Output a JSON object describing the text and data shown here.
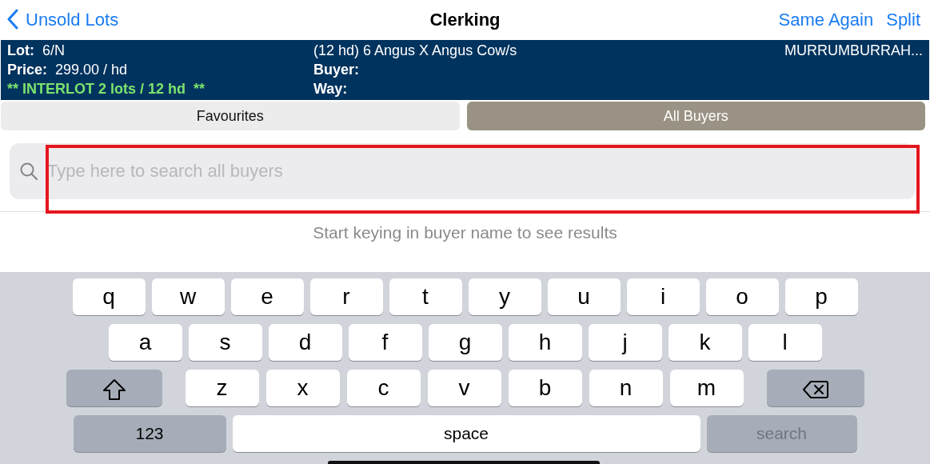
{
  "nav": {
    "back_label": "Unsold Lots",
    "title": "Clerking",
    "actions": [
      "Same Again",
      "Split"
    ]
  },
  "lot_info": {
    "lot_label": "Lot:",
    "lot_value": "6/N",
    "price_label": "Price:",
    "price_value": "299.00 / hd",
    "interlot": "** INTERLOT 2 lots / 12 hd  **",
    "description": "(12 hd) 6 Angus X Angus Cow/s",
    "buyer_label": "Buyer:",
    "way_label": "Way:",
    "location": "MURRUMBURRAH..."
  },
  "tabs": [
    {
      "label": "Favourites",
      "selected": false
    },
    {
      "label": "All Buyers",
      "selected": true
    }
  ],
  "search": {
    "placeholder": "Type here to search all buyers",
    "highlighted": true
  },
  "hint": "Start keying in buyer name to see results",
  "keyboard": {
    "rows": [
      {
        "keys": [
          {
            "kind": "letter",
            "label": "q"
          },
          {
            "kind": "letter",
            "label": "w"
          },
          {
            "kind": "letter",
            "label": "e"
          },
          {
            "kind": "letter",
            "label": "r"
          },
          {
            "kind": "letter",
            "label": "t"
          },
          {
            "kind": "letter",
            "label": "y"
          },
          {
            "kind": "letter",
            "label": "u"
          },
          {
            "kind": "letter",
            "label": "i"
          },
          {
            "kind": "letter",
            "label": "o"
          },
          {
            "kind": "letter",
            "label": "p"
          }
        ]
      },
      {
        "keys": [
          {
            "kind": "letter",
            "label": "a"
          },
          {
            "kind": "letter",
            "label": "s"
          },
          {
            "kind": "letter",
            "label": "d"
          },
          {
            "kind": "letter",
            "label": "f"
          },
          {
            "kind": "letter",
            "label": "g"
          },
          {
            "kind": "letter",
            "label": "h"
          },
          {
            "kind": "letter",
            "label": "j"
          },
          {
            "kind": "letter",
            "label": "k"
          },
          {
            "kind": "letter",
            "label": "l"
          }
        ]
      },
      {
        "keys": [
          {
            "kind": "shift"
          },
          {
            "kind": "letter",
            "label": "z"
          },
          {
            "kind": "letter",
            "label": "x"
          },
          {
            "kind": "letter",
            "label": "c"
          },
          {
            "kind": "letter",
            "label": "v"
          },
          {
            "kind": "letter",
            "label": "b"
          },
          {
            "kind": "letter",
            "label": "n"
          },
          {
            "kind": "letter",
            "label": "m"
          },
          {
            "kind": "backspace"
          }
        ]
      },
      {
        "keys": [
          {
            "kind": "numbers",
            "label": "123"
          },
          {
            "kind": "space",
            "label": "space"
          },
          {
            "kind": "return",
            "label": "search",
            "disabled": true
          }
        ]
      }
    ]
  }
}
